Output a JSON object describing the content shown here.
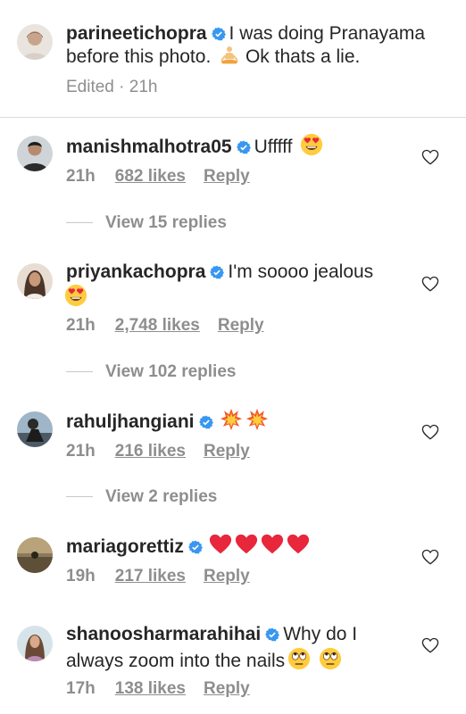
{
  "caption": {
    "username": "parineetichopra",
    "text_line1": "I was doing Pranayama",
    "text_line2": "before this photo.",
    "text_line2_tail": "Ok thats a lie.",
    "edited": "Edited · 21h"
  },
  "comments": [
    {
      "username": "manishmalhotra05",
      "text": "Ufffff",
      "time": "21h",
      "likes": "682 likes",
      "reply": "Reply",
      "view_replies": "View 15 replies"
    },
    {
      "username": "priyankachopra",
      "text": "I'm soooo jealous",
      "time": "21h",
      "likes": "2,748 likes",
      "reply": "Reply",
      "view_replies": "View 102 replies"
    },
    {
      "username": "rahuljhangiani",
      "text": "",
      "time": "21h",
      "likes": "216 likes",
      "reply": "Reply",
      "view_replies": "View 2 replies"
    },
    {
      "username": "mariagorettiz",
      "text": "",
      "time": "19h",
      "likes": "217 likes",
      "reply": "Reply"
    },
    {
      "username": "shanoosharmarahihai",
      "text_line1": "Why do I",
      "text_line2": "always zoom into the nails",
      "time": "17h",
      "likes": "138 likes",
      "reply": "Reply"
    }
  ],
  "colors": {
    "verified": "#3897f0",
    "text": "#262626",
    "muted": "#8e8e8e",
    "heart_red": "#ed4956"
  },
  "icons": [
    "verified-badge",
    "heart-outline-icon",
    "heart-eyes-emoji",
    "meditation-emoji",
    "collision-emoji",
    "red-heart-emoji",
    "eye-roll-emoji"
  ]
}
